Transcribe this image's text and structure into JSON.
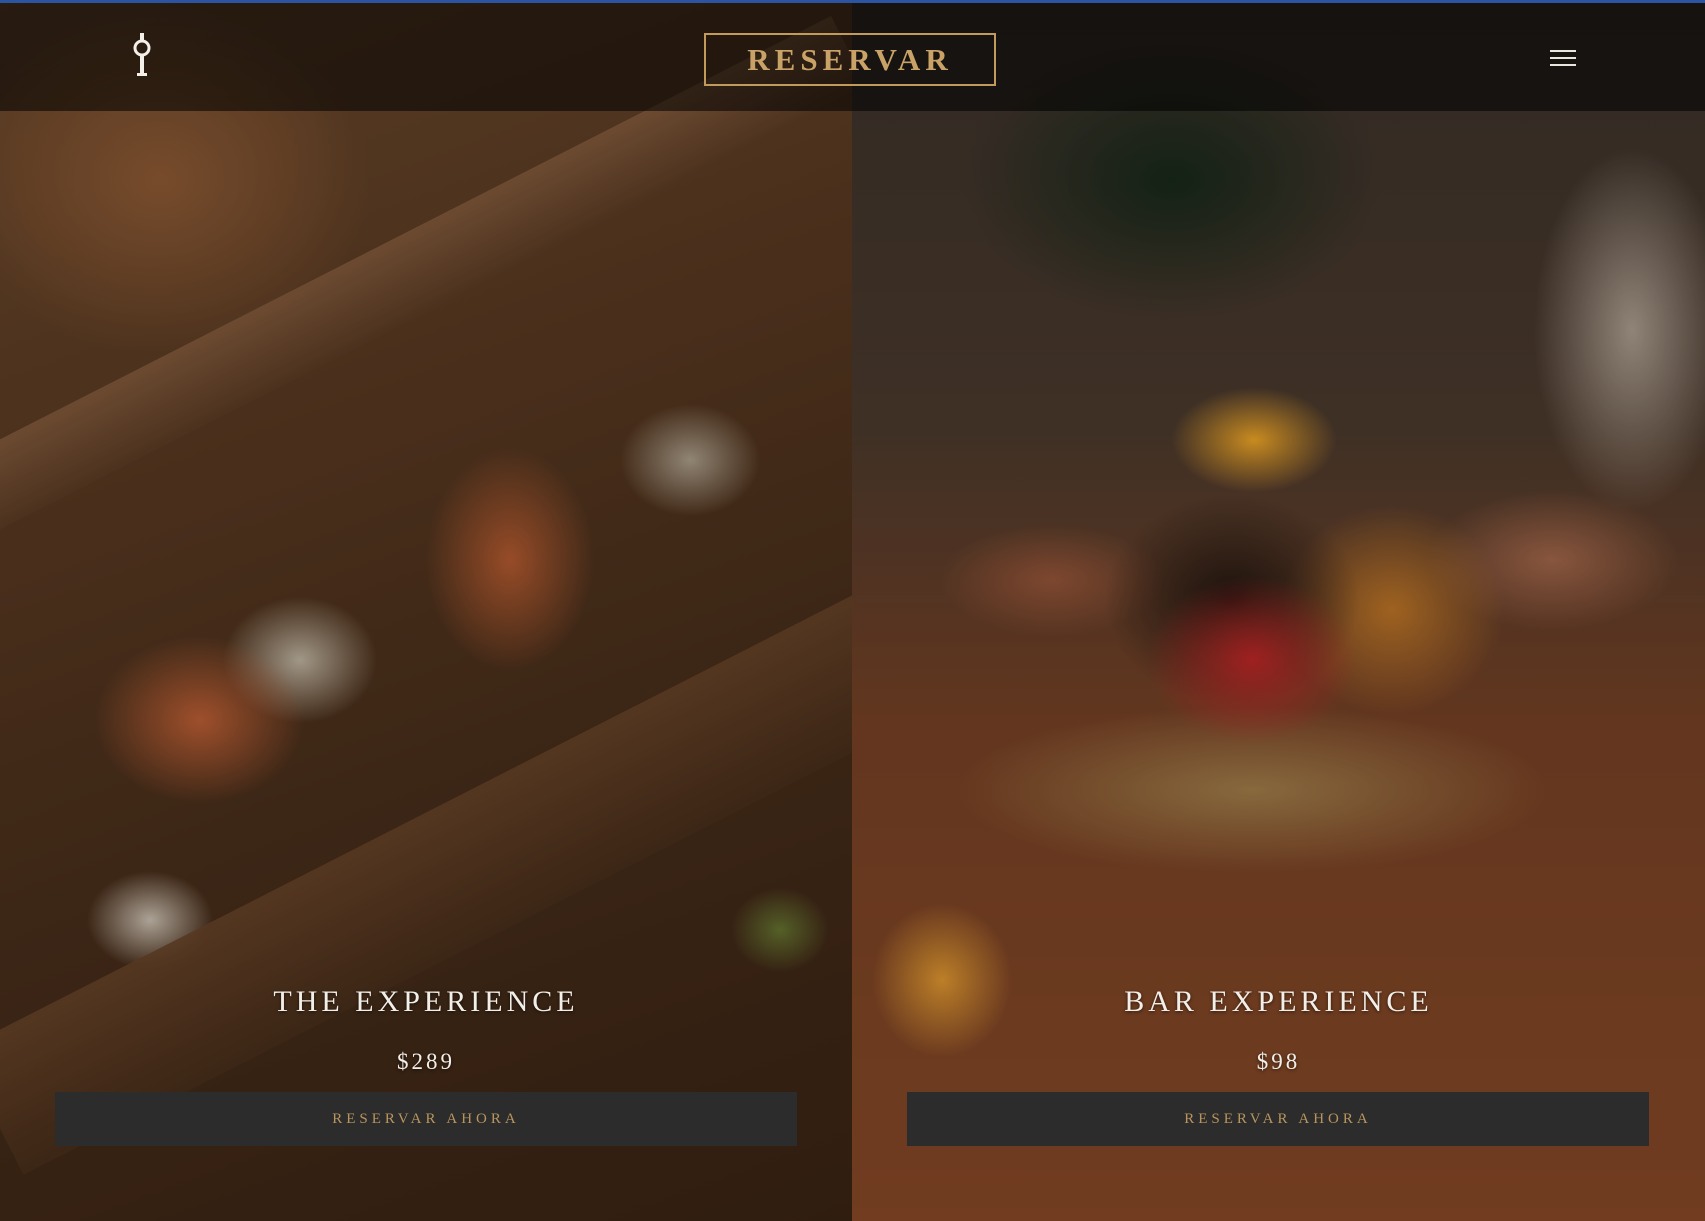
{
  "header": {
    "logo_icon": "key-icon",
    "reserve_label": "RESERVAR",
    "menu_icon": "hamburger-menu-icon"
  },
  "offers": [
    {
      "title": "THE EXPERIENCE",
      "price": "$289",
      "button_label": "RESERVAR AHORA"
    },
    {
      "title": "BAR EXPERIENCE",
      "price": "$98",
      "button_label": "RESERVAR AHORA"
    }
  ],
  "colors": {
    "accent_gold": "#c29a5c",
    "button_bg": "#2c2c2c",
    "top_accent": "#2b55a3"
  }
}
